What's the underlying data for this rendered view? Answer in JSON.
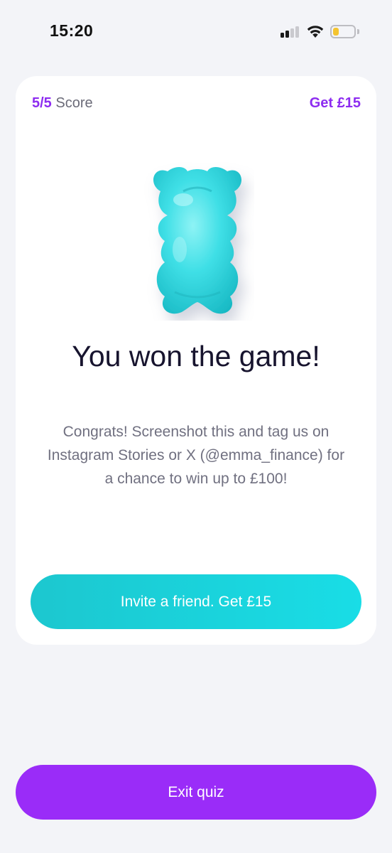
{
  "status_bar": {
    "time": "15:20",
    "signal_bars_active": 2,
    "signal_bars_total": 4,
    "battery_level": 0.3,
    "battery_color": "#f4c430"
  },
  "quiz": {
    "score_value": "5/5",
    "score_label": " Score",
    "reward_link": "Get £15"
  },
  "result": {
    "illustration": "gummy-bear-icon",
    "headline": "You won the game!",
    "body": "Congrats! Screenshot this and tag us on Instagram Stories or X (@emma_finance) for a chance to win up to £100!"
  },
  "actions": {
    "invite_label": "Invite a friend. Get £15",
    "exit_label": "Exit quiz"
  },
  "colors": {
    "accent_purple": "#9a2cf8",
    "accent_teal": "#1cd3dc",
    "background": "#f3f4f8"
  }
}
